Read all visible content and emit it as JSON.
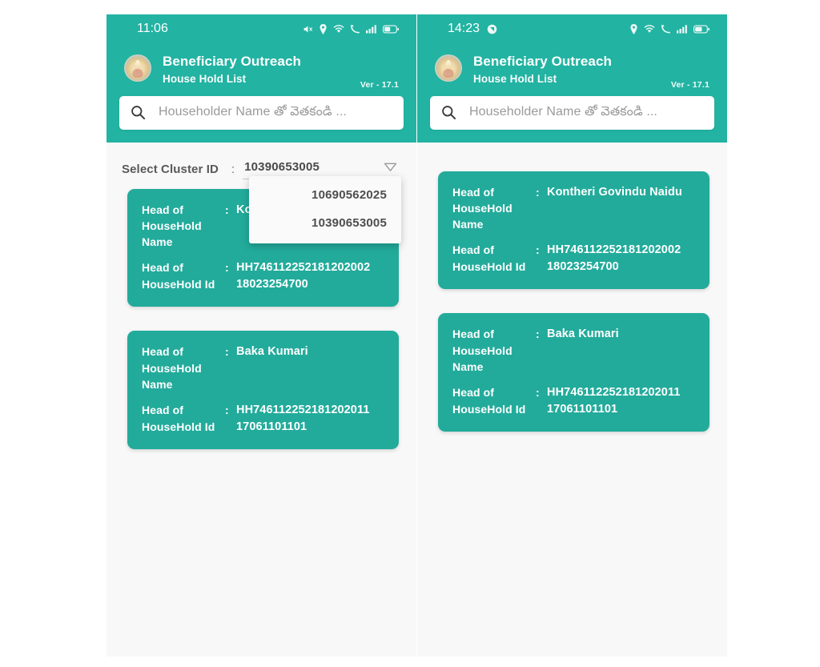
{
  "accent": {
    "header_teal": "#22b3a2",
    "card_teal": "#22ab9b",
    "page_bg": "#f8f8f8"
  },
  "phones": [
    {
      "id": "left",
      "statusbar": {
        "time": "11:06",
        "icons_left": [
          "mute-icon"
        ],
        "icons_right": [
          "location-pin-icon",
          "wifi-icon",
          "mobile-data-icon",
          "signal-bars-icon",
          "battery-icon"
        ]
      },
      "appbar": {
        "logo": "government-emblem-icon",
        "title": "Beneficiary Outreach",
        "subtitle": "House Hold List",
        "version": "Ver - 17.1"
      },
      "search": {
        "icon": "search-icon",
        "placeholder": "Householder Name తో వెతకండి ...",
        "value": ""
      },
      "cluster": {
        "label": "Select Cluster ID",
        "colon": ":",
        "selected": "10390653005",
        "chevron": "chevron-down-icon",
        "dropdown_open": true,
        "options": [
          "10690562025",
          "10390653005"
        ]
      },
      "cards": [
        {
          "name_key": "Head of HouseHold Name",
          "name_sep": ":",
          "name_value": "Kontheri Govindu Naidu",
          "id_key": "Head of HouseHold Id",
          "id_sep": ":",
          "id_value": "HH74611225218120200218023254700"
        },
        {
          "name_key": "Head of HouseHold Name",
          "name_sep": ":",
          "name_value": "Baka Kumari",
          "id_key": "Head of HouseHold Id",
          "id_sep": ":",
          "id_value": "HH74611225218120201117061101101"
        }
      ]
    },
    {
      "id": "right",
      "statusbar": {
        "time": "14:23",
        "icons_left": [
          "screen-record-icon"
        ],
        "icons_right": [
          "location-pin-icon",
          "wifi-icon",
          "mobile-data-icon",
          "signal-bars-icon",
          "battery-icon"
        ]
      },
      "appbar": {
        "logo": "government-emblem-icon",
        "title": "Beneficiary Outreach",
        "subtitle": "House Hold List",
        "version": "Ver - 17.1"
      },
      "search": {
        "icon": "search-icon",
        "placeholder": "Householder Name తో వెతకండి ...",
        "value": ""
      },
      "cluster": {
        "dropdown_open": false
      },
      "cards": [
        {
          "name_key": "Head of HouseHold Name",
          "name_sep": ":",
          "name_value": "Kontheri Govindu Naidu",
          "id_key": "Head of HouseHold Id",
          "id_sep": ":",
          "id_value": "HH74611225218120200218023254700"
        },
        {
          "name_key": "Head of HouseHold Name",
          "name_sep": ":",
          "name_value": "Baka Kumari",
          "id_key": "Head of HouseHold Id",
          "id_sep": ":",
          "id_value": "HH74611225218120201117061101101"
        }
      ]
    }
  ]
}
